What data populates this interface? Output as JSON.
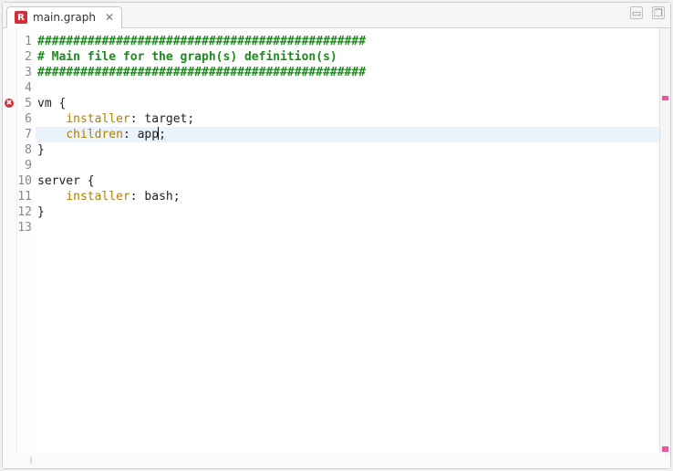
{
  "tab": {
    "icon_letter": "R",
    "title": "main.graph",
    "close_glyph": "✕"
  },
  "window_controls": {
    "minimize": "▭",
    "restore": "❐"
  },
  "editor": {
    "error_line": 5,
    "current_line": 7,
    "lines": [
      {
        "n": 1,
        "tokens": [
          {
            "cls": "tok-comment",
            "t": "##############################################"
          }
        ]
      },
      {
        "n": 2,
        "tokens": [
          {
            "cls": "tok-comment",
            "t": "# Main file for the graph(s) definition(s)"
          }
        ]
      },
      {
        "n": 3,
        "tokens": [
          {
            "cls": "tok-comment",
            "t": "##############################################"
          }
        ]
      },
      {
        "n": 4,
        "tokens": []
      },
      {
        "n": 5,
        "tokens": [
          {
            "cls": "tok-plain",
            "t": "vm {"
          }
        ]
      },
      {
        "n": 6,
        "tokens": [
          {
            "cls": "tok-plain",
            "t": "    "
          },
          {
            "cls": "tok-key",
            "t": "installer"
          },
          {
            "cls": "tok-punc",
            "t": ": target;"
          }
        ]
      },
      {
        "n": 7,
        "tokens": [
          {
            "cls": "tok-plain",
            "t": "    "
          },
          {
            "cls": "tok-key",
            "t": "children"
          },
          {
            "cls": "tok-punc",
            "t": ": app"
          },
          {
            "cls": "cursor",
            "t": ""
          },
          {
            "cls": "tok-punc",
            "t": ";"
          }
        ]
      },
      {
        "n": 8,
        "tokens": [
          {
            "cls": "tok-plain",
            "t": "}"
          }
        ]
      },
      {
        "n": 9,
        "tokens": []
      },
      {
        "n": 10,
        "tokens": [
          {
            "cls": "tok-plain",
            "t": "server {"
          }
        ]
      },
      {
        "n": 11,
        "tokens": [
          {
            "cls": "tok-plain",
            "t": "    "
          },
          {
            "cls": "tok-key",
            "t": "installer"
          },
          {
            "cls": "tok-punc",
            "t": ": bash;"
          }
        ]
      },
      {
        "n": 12,
        "tokens": [
          {
            "cls": "tok-plain",
            "t": "}"
          }
        ]
      },
      {
        "n": 13,
        "tokens": []
      }
    ]
  },
  "colors": {
    "comment": "#1a8c1a",
    "key": "#b08000",
    "current_line_bg": "#eaf2fb",
    "error": "#d32f3a",
    "overview_mark": "#e05a9c"
  }
}
